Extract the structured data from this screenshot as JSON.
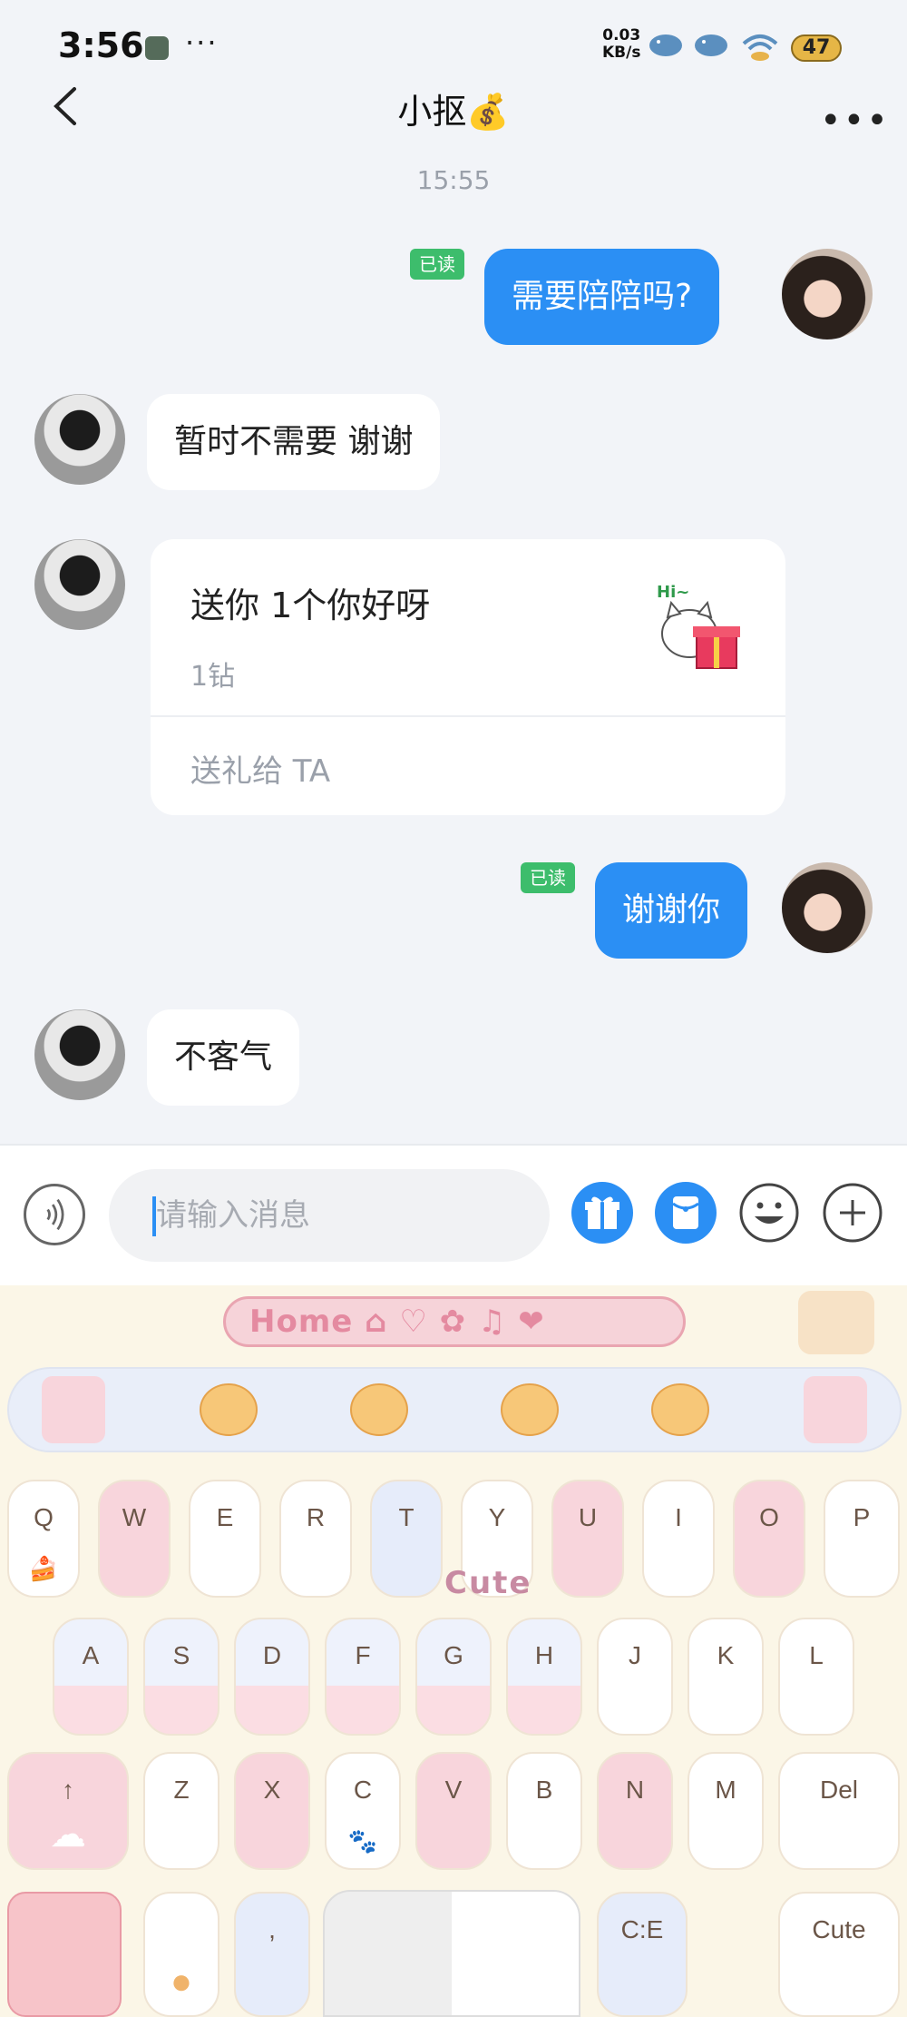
{
  "status_bar": {
    "time": "3:56",
    "dots": "···",
    "net_speed": "0.03",
    "net_unit": "KB/s",
    "battery": "47"
  },
  "header": {
    "title": "小抠💰"
  },
  "chat": {
    "timestamp": "15:55",
    "read_label": "已读",
    "msg1": "需要陪陪吗?",
    "msg2": "暂时不需要 谢谢",
    "gift": {
      "title": "送你 1个你好呀",
      "price": "1钻",
      "action": "送礼给 TA",
      "sticker_text": "Hi~"
    },
    "msg3": "谢谢你",
    "msg4": "不客气"
  },
  "input_bar": {
    "placeholder": "请输入消息"
  },
  "keyboard": {
    "banner": "Home",
    "row1": [
      "Q",
      "W",
      "E",
      "R",
      "T",
      "Y",
      "U",
      "I",
      "O",
      "P"
    ],
    "row2": [
      "A",
      "S",
      "D",
      "F",
      "G",
      "H",
      "J",
      "K",
      "L"
    ],
    "row3": [
      "↑",
      "Z",
      "X",
      "C",
      "V",
      "B",
      "N",
      "M",
      "Del"
    ],
    "row4": [
      ",",
      "C:E",
      "Cute"
    ],
    "cute_deco": "Cute"
  }
}
